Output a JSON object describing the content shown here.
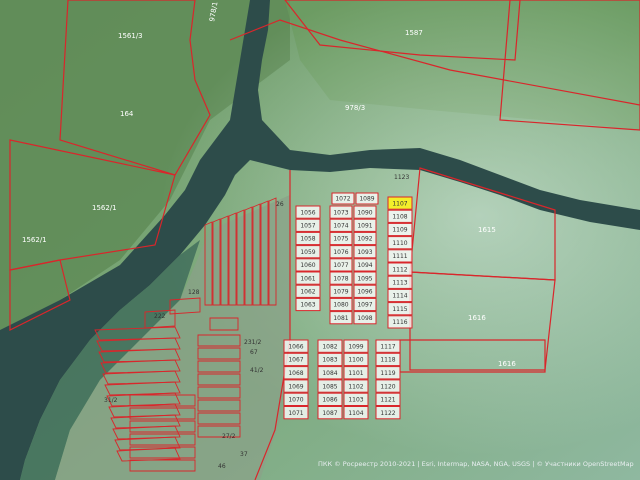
{
  "map": {
    "big_labels": [
      {
        "text": "1561/3"
      },
      {
        "text": "1587"
      },
      {
        "text": "978/1"
      },
      {
        "text": "164"
      },
      {
        "text": "978/3"
      },
      {
        "text": "1562/1"
      },
      {
        "text": "1562/1"
      },
      {
        "text": "1615"
      },
      {
        "text": "1616"
      },
      {
        "text": "1616"
      },
      {
        "text": "1123"
      },
      {
        "text": "128"
      },
      {
        "text": "222"
      },
      {
        "text": "231/2"
      },
      {
        "text": "67"
      },
      {
        "text": "41/2"
      },
      {
        "text": "31/2"
      },
      {
        "text": "27/2"
      },
      {
        "text": "37"
      },
      {
        "text": "46"
      },
      {
        "text": "26"
      }
    ],
    "block_a": {
      "row1": [
        "1072",
        "1089"
      ],
      "col1": [
        "1056",
        "1057",
        "1058",
        "1059",
        "1060",
        "1061",
        "1062",
        "1063"
      ],
      "col2": [
        "1073",
        "1074",
        "1075",
        "1076",
        "1077",
        "1078",
        "1079",
        "1080",
        "1081"
      ],
      "col3": [
        "1090",
        "1091",
        "1092",
        "1093",
        "1094",
        "1095",
        "1096",
        "1097",
        "1098"
      ],
      "col4": [
        "1107",
        "1108",
        "1109",
        "1110",
        "1111",
        "1112",
        "1113",
        "1114",
        "1115",
        "1116"
      ]
    },
    "block_b": {
      "col1": [
        "1066",
        "1067",
        "1068",
        "1069",
        "1070",
        "1071"
      ],
      "col2": [
        "1082",
        "1083",
        "1084",
        "1085",
        "1086",
        "1087"
      ],
      "col3": [
        "1099",
        "1100",
        "1101",
        "1102",
        "1103",
        "1104"
      ],
      "col4": [
        "1117",
        "1118",
        "1119",
        "1120",
        "1121",
        "1122"
      ]
    },
    "highlight": "1107",
    "attribution": "ПКК © Росреестр 2010-2021 | Esri, Intermap, NASA, NGA, USGS | © Участники OpenStreetMap",
    "colors": {
      "parcel_border": "#d9262b",
      "highlight": "#f3ef2a",
      "river": "#2b4a4a",
      "field": "#5c8a5e"
    }
  }
}
